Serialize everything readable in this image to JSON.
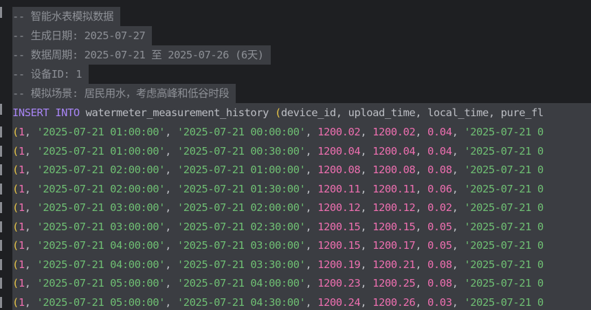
{
  "comments": [
    "-- 智能水表模拟数据",
    "-- 生成日期: 2025-07-27",
    "-- 数据周期: 2025-07-21 至 2025-07-26 (6天)",
    "-- 设备ID: 1",
    "-- 模拟场景: 居民用水，考虑高峰和低谷时段"
  ],
  "insert": {
    "kw1": "INSERT",
    "kw2": "INTO",
    "table": "watermeter_measurement_history",
    "paren": "(",
    "columns": "device_id, upload_time, local_time, pure_fl"
  },
  "rows": [
    {
      "id": "1",
      "upload": "'2025-07-21 01:00:00'",
      "local": "'2025-07-21 00:00:00'",
      "v1": "1200.02",
      "v2": "1200.02",
      "v3": "0.04",
      "next": "'2025-07-21 0"
    },
    {
      "id": "1",
      "upload": "'2025-07-21 01:00:00'",
      "local": "'2025-07-21 00:30:00'",
      "v1": "1200.04",
      "v2": "1200.04",
      "v3": "0.04",
      "next": "'2025-07-21 0"
    },
    {
      "id": "1",
      "upload": "'2025-07-21 02:00:00'",
      "local": "'2025-07-21 01:00:00'",
      "v1": "1200.08",
      "v2": "1200.08",
      "v3": "0.08",
      "next": "'2025-07-21 0"
    },
    {
      "id": "1",
      "upload": "'2025-07-21 02:00:00'",
      "local": "'2025-07-21 01:30:00'",
      "v1": "1200.11",
      "v2": "1200.11",
      "v3": "0.06",
      "next": "'2025-07-21 0"
    },
    {
      "id": "1",
      "upload": "'2025-07-21 03:00:00'",
      "local": "'2025-07-21 02:00:00'",
      "v1": "1200.12",
      "v2": "1200.12",
      "v3": "0.02",
      "next": "'2025-07-21 0"
    },
    {
      "id": "1",
      "upload": "'2025-07-21 03:00:00'",
      "local": "'2025-07-21 02:30:00'",
      "v1": "1200.15",
      "v2": "1200.15",
      "v3": "0.05",
      "next": "'2025-07-21 0"
    },
    {
      "id": "1",
      "upload": "'2025-07-21 04:00:00'",
      "local": "'2025-07-21 03:00:00'",
      "v1": "1200.15",
      "v2": "1200.17",
      "v3": "0.05",
      "next": "'2025-07-21 0"
    },
    {
      "id": "1",
      "upload": "'2025-07-21 04:00:00'",
      "local": "'2025-07-21 03:30:00'",
      "v1": "1200.19",
      "v2": "1200.21",
      "v3": "0.08",
      "next": "'2025-07-21 0"
    },
    {
      "id": "1",
      "upload": "'2025-07-21 05:00:00'",
      "local": "'2025-07-21 04:00:00'",
      "v1": "1200.23",
      "v2": "1200.25",
      "v3": "0.08",
      "next": "'2025-07-21 0"
    },
    {
      "id": "1",
      "upload": "'2025-07-21 05:00:00'",
      "local": "'2025-07-21 04:30:00'",
      "v1": "1200.24",
      "v2": "1200.26",
      "v3": "0.03",
      "next": "'2025-07-21 0"
    }
  ],
  "colors": {
    "background": "#1e1f22",
    "selection": "#3b3d42",
    "comment": "#8d9096",
    "keyword": "#a885f5",
    "string": "#6fbf73",
    "number": "#ee6fb0",
    "paren": "#e7c547"
  }
}
